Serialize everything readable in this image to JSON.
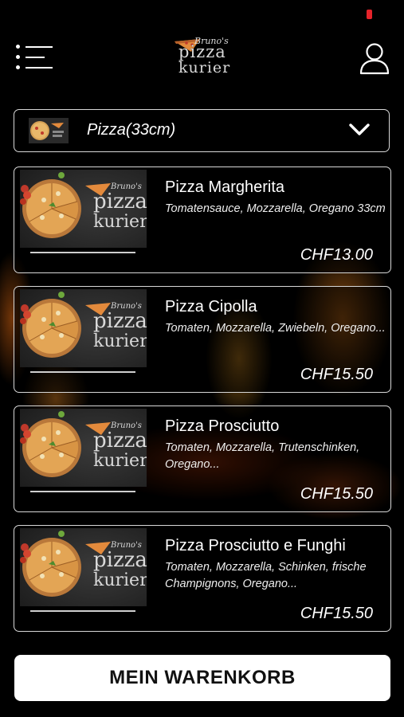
{
  "header": {
    "menu_icon": "hamburger-menu-icon",
    "logo": {
      "line1": "Bruno's",
      "line2": "pizza",
      "line3": "kurier"
    },
    "user_icon": "user-icon"
  },
  "category_select": {
    "selected": "Pizza(33cm)",
    "icon": "chevron-down-icon"
  },
  "products": [
    {
      "name": "Pizza Margherita",
      "description": "Tomatensauce, Mozzarella, Oregano 33cm",
      "price": "CHF13.00"
    },
    {
      "name": "Pizza Cipolla",
      "description": "Tomaten, Mozzarella, Zwiebeln, Oregano...",
      "price": "CHF15.50"
    },
    {
      "name": "Pizza Prosciutto",
      "description": "Tomaten, Mozzarella, Trutenschinken, Oregano...",
      "price": "CHF15.50"
    },
    {
      "name": "Pizza Prosciutto e Funghi",
      "description": "Tomaten, Mozzarella, Schinken, frische Champignons, Oregano...",
      "price": "CHF15.50"
    }
  ],
  "cart": {
    "label": "MEIN WARENKORB"
  },
  "colors": {
    "background": "#000000",
    "border": "#d8d8d8",
    "status_indicator": "#e5232a",
    "button_bg": "#ffffff"
  }
}
